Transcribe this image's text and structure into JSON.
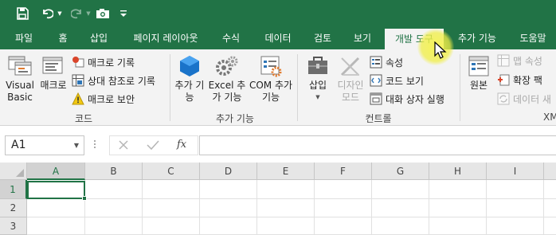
{
  "quick_access": {
    "save_icon": "save-icon",
    "undo_icon": "undo-icon",
    "redo_icon": "redo-icon",
    "camera_icon": "camera-icon",
    "customize_icon": "customize-qat-icon"
  },
  "tabs": [
    {
      "label": "파일"
    },
    {
      "label": "홈"
    },
    {
      "label": "삽입"
    },
    {
      "label": "페이지 레이아웃"
    },
    {
      "label": "수식"
    },
    {
      "label": "데이터"
    },
    {
      "label": "검토"
    },
    {
      "label": "보기"
    },
    {
      "label": "개발 도구",
      "active": true
    },
    {
      "label": "추가 기능"
    },
    {
      "label": "도움말"
    }
  ],
  "ribbon": {
    "code": {
      "group_label": "코드",
      "visual_basic": "Visual Basic",
      "macro": "매크로",
      "record_macro": "매크로 기록",
      "relative_ref": "상대 참조로 기록",
      "macro_security": "매크로 보안"
    },
    "addins": {
      "group_label": "추가 기능",
      "addins": "추가 기능",
      "excel_addins": "Excel 추가 기능",
      "com_addins": "COM 추가 기능"
    },
    "controls": {
      "group_label": "컨트롤",
      "insert": "삽입",
      "design_mode": "디자인 모드",
      "properties": "속성",
      "view_code": "코드 보기",
      "run_dialog": "대화 상자 실행"
    },
    "xml": {
      "group_label": "XM",
      "source": "원본",
      "map_properties": "맵 속성",
      "expansion_packs": "확장 팩",
      "refresh_data": "데이터 새"
    }
  },
  "formula_bar": {
    "name_box": "A1",
    "fx_label": "fx",
    "cancel_icon": "cancel-icon",
    "enter_icon": "check-icon",
    "formula": ""
  },
  "grid": {
    "columns": [
      "A",
      "B",
      "C",
      "D",
      "E",
      "F",
      "G",
      "H",
      "I"
    ],
    "rows": [
      "1",
      "2",
      "3"
    ],
    "active_cell": "A1"
  },
  "colors": {
    "brand": "#217346",
    "ribbon_bg": "#f3f3f3",
    "header_bg": "#e6e6e6"
  }
}
